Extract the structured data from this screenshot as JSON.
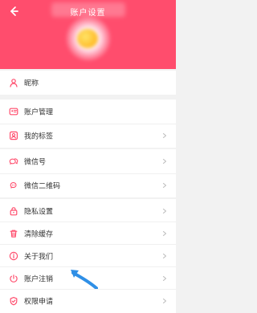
{
  "header": {
    "title": "账户设置",
    "back_icon": "arrow-left-icon",
    "avatar_icon": "avatar-blurred"
  },
  "colors": {
    "brand": "#ff4d6d",
    "background": "#f2f2f2",
    "card": "#ffffff",
    "text": "#333333",
    "icon": "#ff4d6d",
    "annotation_arrow": "#2f8fe6"
  },
  "sections": [
    {
      "items": [
        {
          "label": "昵称",
          "icon": "person-icon",
          "chevron": false
        }
      ]
    },
    {
      "items": [
        {
          "label": "账户管理",
          "icon": "id-card-icon",
          "chevron": false
        },
        {
          "label": "我的标签",
          "icon": "tag-icon",
          "chevron": true
        }
      ]
    },
    {
      "items": [
        {
          "label": "微信号",
          "icon": "wechat-icon",
          "chevron": true
        },
        {
          "label": "微信二维码",
          "icon": "qrcode-icon",
          "chevron": true
        }
      ]
    },
    {
      "items": [
        {
          "label": "隐私设置",
          "icon": "lock-icon",
          "chevron": true
        },
        {
          "label": "清除缓存",
          "icon": "trash-icon",
          "chevron": true
        },
        {
          "label": "关于我们",
          "icon": "info-icon",
          "chevron": true
        },
        {
          "label": "账户注销",
          "icon": "power-icon",
          "chevron": true
        },
        {
          "label": "权限申请",
          "icon": "shield-icon",
          "chevron": true
        }
      ]
    }
  ]
}
